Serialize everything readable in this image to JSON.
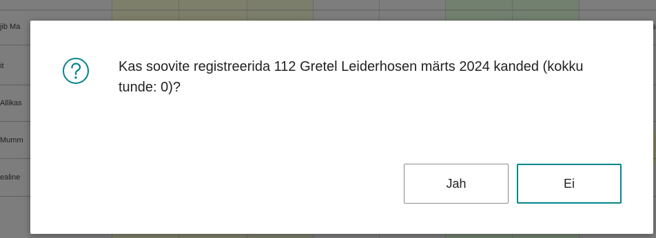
{
  "dialog": {
    "message": "Kas soovite registreerida 112 Gretel Leiderhosen märts 2024 kanded (kokku tunde: 0)?",
    "yes_label": "Jah",
    "no_label": "Ei",
    "icon": "question-circle-icon",
    "accent_color": "#008489"
  },
  "background": {
    "row_labels": [
      "jib Ma",
      "it",
      "Allikas",
      "Mumm",
      "ealine"
    ],
    "right_fragment": "s"
  }
}
